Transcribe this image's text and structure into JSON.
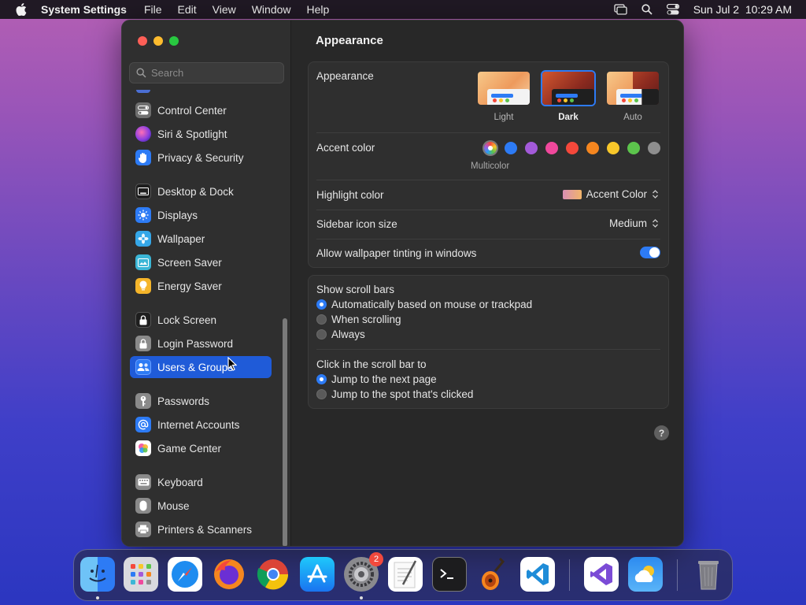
{
  "menubar": {
    "app_name": "System Settings",
    "menus": [
      "File",
      "Edit",
      "View",
      "Window",
      "Help"
    ],
    "datetime": "Sun Jul 2  10:29 AM"
  },
  "sidebar": {
    "search_placeholder": "Search",
    "items": [
      {
        "label": "Control Center",
        "icon": "control-center-icon",
        "color": "#6e6e6e"
      },
      {
        "label": "Siri & Spotlight",
        "icon": "siri-icon",
        "color": "#b23fd4"
      },
      {
        "label": "Privacy & Security",
        "icon": "hand-icon",
        "color": "#2d7bf5"
      },
      {
        "label": "Desktop & Dock",
        "icon": "desktop-icon",
        "color": "#1e1e1e"
      },
      {
        "label": "Displays",
        "icon": "sun-icon",
        "color": "#2d7bf5"
      },
      {
        "label": "Wallpaper",
        "icon": "flower-icon",
        "color": "#35a7e8"
      },
      {
        "label": "Screen Saver",
        "icon": "screen-saver-icon",
        "color": "#3bb6d6"
      },
      {
        "label": "Energy Saver",
        "icon": "bulb-icon",
        "color": "#f5b52a"
      },
      {
        "label": "Lock Screen",
        "icon": "lock-icon",
        "color": "#1e1e1e"
      },
      {
        "label": "Login Password",
        "icon": "lock-icon",
        "color": "#8a8a8a"
      },
      {
        "label": "Users & Groups",
        "icon": "users-icon",
        "color": "#2d7bf5",
        "selected": true
      },
      {
        "label": "Passwords",
        "icon": "key-icon",
        "color": "#8a8a8a"
      },
      {
        "label": "Internet Accounts",
        "icon": "at-icon",
        "color": "#2d7bf5"
      },
      {
        "label": "Game Center",
        "icon": "game-center-icon",
        "color": "#ffffff"
      },
      {
        "label": "Keyboard",
        "icon": "keyboard-icon",
        "color": "#8a8a8a"
      },
      {
        "label": "Mouse",
        "icon": "mouse-icon",
        "color": "#8a8a8a"
      },
      {
        "label": "Printers & Scanners",
        "icon": "printer-icon",
        "color": "#8a8a8a"
      }
    ]
  },
  "main": {
    "title": "Appearance",
    "appearance": {
      "label": "Appearance",
      "options": [
        {
          "label": "Light",
          "selected": false
        },
        {
          "label": "Dark",
          "selected": true
        },
        {
          "label": "Auto",
          "selected": false
        }
      ]
    },
    "accent": {
      "label": "Accent color",
      "caption": "Multicolor",
      "colors": [
        "#2d7bf5",
        "#a35ad9",
        "#f0489c",
        "#f5483b",
        "#f5861f",
        "#f8c72a",
        "#5cc44c",
        "#8e8e8e"
      ]
    },
    "highlight": {
      "label": "Highlight color",
      "value": "Accent Color"
    },
    "sidebar_icon_size": {
      "label": "Sidebar icon size",
      "value": "Medium"
    },
    "wallpaper_tinting": {
      "label": "Allow wallpaper tinting in windows",
      "enabled": true
    },
    "scroll_bars": {
      "label": "Show scroll bars",
      "options": [
        {
          "label": "Automatically based on mouse or trackpad",
          "selected": true
        },
        {
          "label": "When scrolling",
          "selected": false
        },
        {
          "label": "Always",
          "selected": false
        }
      ]
    },
    "click_scroll": {
      "label": "Click in the scroll bar to",
      "options": [
        {
          "label": "Jump to the next page",
          "selected": true
        },
        {
          "label": "Jump to the spot that's clicked",
          "selected": false
        }
      ]
    },
    "help_label": "?"
  },
  "dock": {
    "apps": [
      "Finder",
      "Launchpad",
      "Safari",
      "Firefox",
      "Chrome",
      "App Store",
      "System Settings",
      "TextEdit",
      "Terminal",
      "GarageBand",
      "VS Code",
      "Visual Studio",
      "Weather",
      "Trash"
    ],
    "settings_badge": "2"
  }
}
